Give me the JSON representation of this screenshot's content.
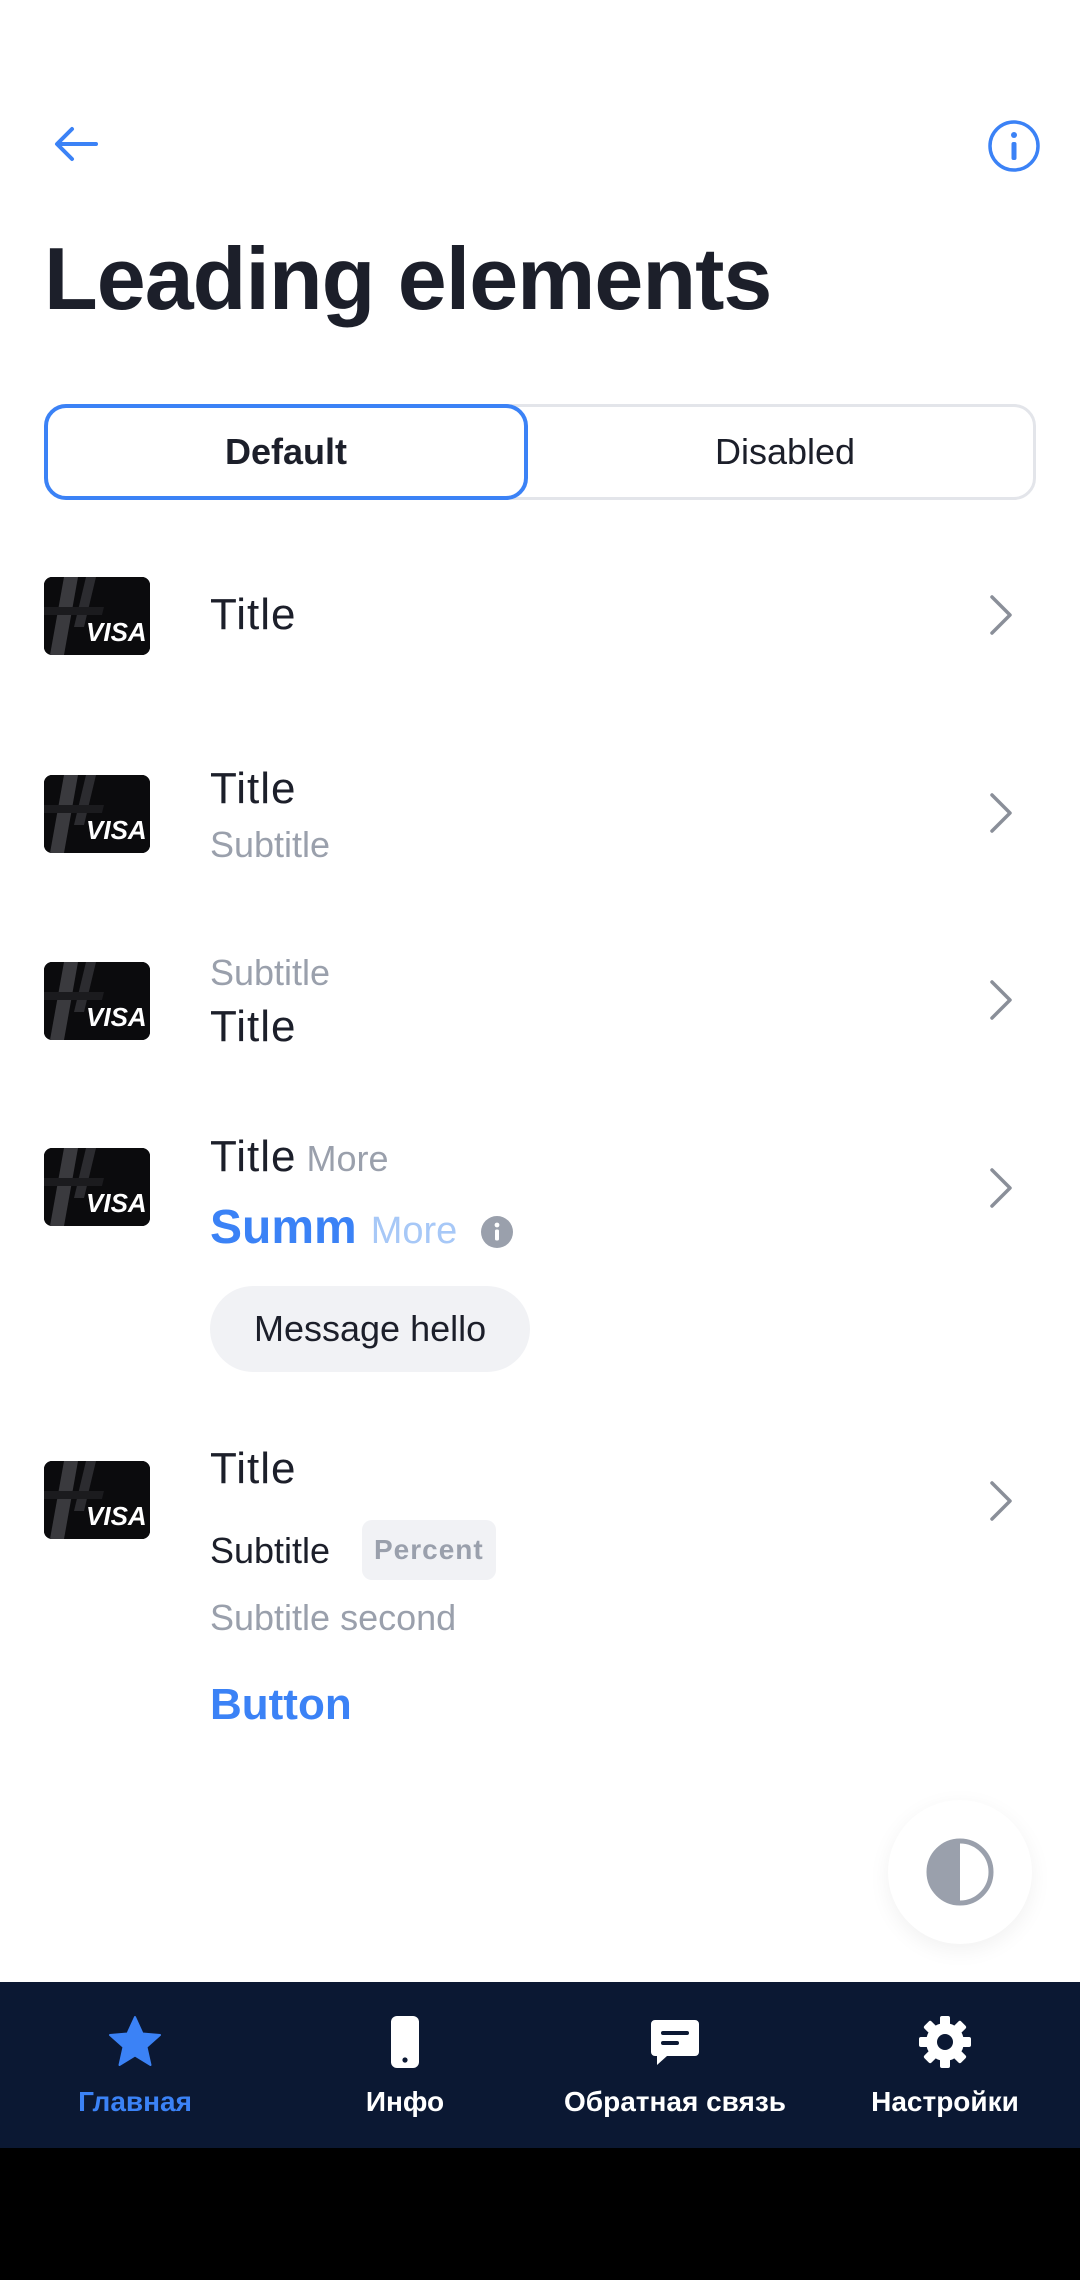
{
  "header": {
    "title": "Leading elements"
  },
  "segmented": {
    "options": [
      "Default",
      "Disabled"
    ],
    "selected": "Default"
  },
  "rows": [
    {
      "title": "Title"
    },
    {
      "title": "Title",
      "subtitle": "Subtitle"
    },
    {
      "subtitle": "Subtitle",
      "title": "Title"
    },
    {
      "title": "Title",
      "title_more": "More",
      "summ": "Summ",
      "summ_more": "More",
      "chip": "Message hello"
    },
    {
      "title": "Title",
      "subtitle": "Subtitle",
      "badge": "Percent",
      "subtitle_second": "Subtitle second",
      "button": "Button"
    }
  ],
  "card_brand": "VISA",
  "bottom_nav": {
    "items": [
      {
        "label": "Главная",
        "icon": "star-icon",
        "active": true
      },
      {
        "label": "Инфо",
        "icon": "phone-icon",
        "active": false
      },
      {
        "label": "Обратная связь",
        "icon": "chat-icon",
        "active": false
      },
      {
        "label": "Настройки",
        "icon": "gear-icon",
        "active": false
      }
    ]
  },
  "colors": {
    "accent": "#3b82f6",
    "nav_bg": "#0b1833",
    "text": "#1c1f2a",
    "muted": "#9aa0ac"
  }
}
